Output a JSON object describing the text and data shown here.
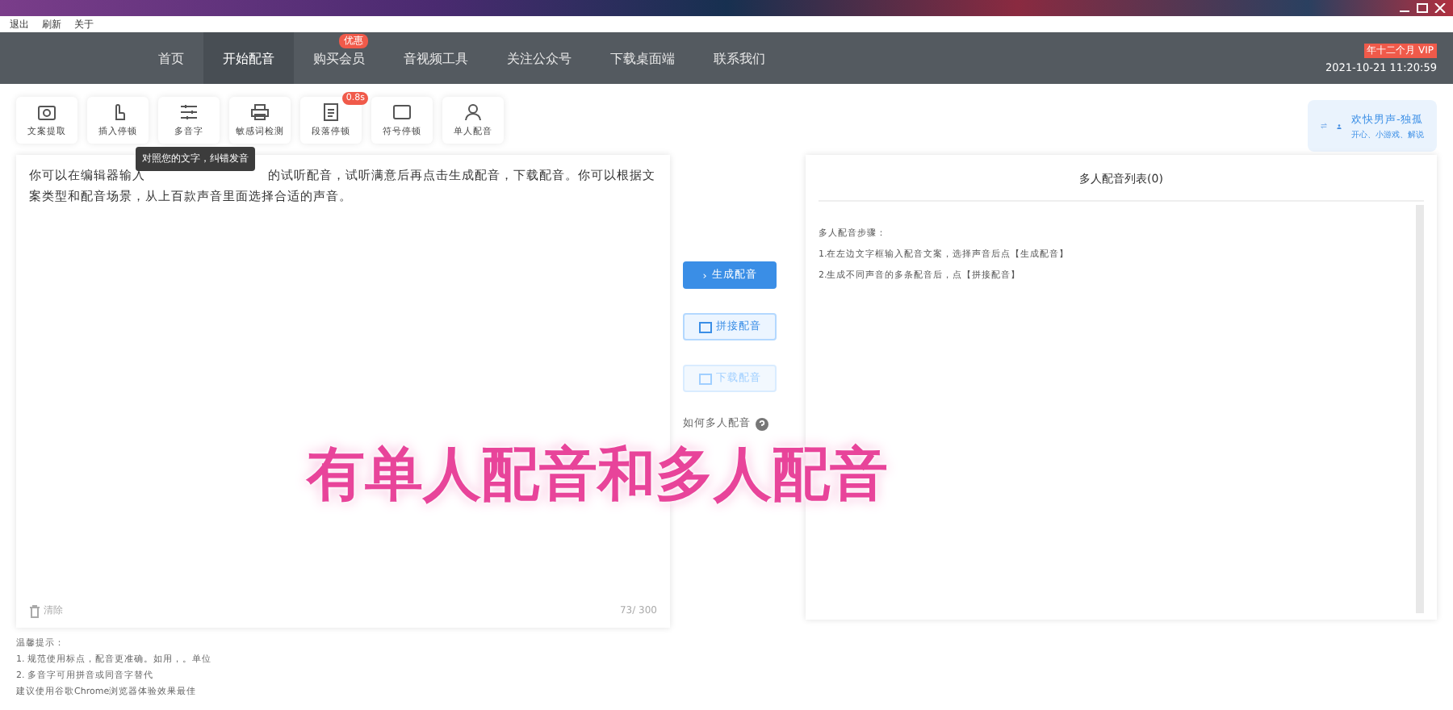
{
  "menu_bar": [
    "退出",
    "刷新",
    "关于"
  ],
  "nav": {
    "items": [
      {
        "label": "首页",
        "selected": false
      },
      {
        "label": "开始配音",
        "selected": true
      },
      {
        "label": "购买会员",
        "selected": false,
        "badge": "优惠"
      },
      {
        "label": "音视频工具",
        "selected": false
      },
      {
        "label": "关注公众号",
        "selected": false
      },
      {
        "label": "下载桌面端",
        "selected": false
      },
      {
        "label": "联系我们",
        "selected": false
      }
    ],
    "vip_badge": "年十二个月 VIP",
    "datetime": "2021-10-21 11:20:59"
  },
  "toolbar": [
    {
      "label": "文案提取"
    },
    {
      "label": "插入停顿"
    },
    {
      "label": "多音字",
      "tooltip": "对照您的文字，纠错发音"
    },
    {
      "label": "敏感词检测"
    },
    {
      "label": "段落停顿",
      "badge": "0.8s"
    },
    {
      "label": "符号停顿"
    },
    {
      "label": "单人配音"
    }
  ],
  "voice": {
    "name": "欢快男声-独孤",
    "tags": "开心、小游戏、解说"
  },
  "editor": {
    "text_before": "你可以在编辑器输入",
    "text_after": "的试听配音，试听满意后再点击生成配音，下载配音。你可以根据文案类型和配音场景，从上百款声音里面选择合适的声音。",
    "clear": "清除",
    "count": "73/ 300"
  },
  "actions": [
    {
      "label": "生成配音",
      "kind": "primary",
      "icon": "›"
    },
    {
      "label": "拼接配音",
      "kind": "secondary"
    },
    {
      "label": "下载配音",
      "kind": "disabled"
    }
  ],
  "help_link": "如何多人配音",
  "list_panel": {
    "title": "多人配音列表(0)",
    "lines": [
      "多人配音步骤：",
      "1.在左边文字框输入配音文案，选择声音后点【生成配音】",
      "2.生成不同声音的多条配音后，点【拼接配音】"
    ]
  },
  "tips": [
    "温馨提示：",
    "1. 规范使用标点，配音更准确。如用，。单位",
    "2. 多音字可用拼音或同音字替代",
    "建议使用谷歌Chrome浏览器体验效果最佳"
  ],
  "caption": "有单人配音和多人配音"
}
